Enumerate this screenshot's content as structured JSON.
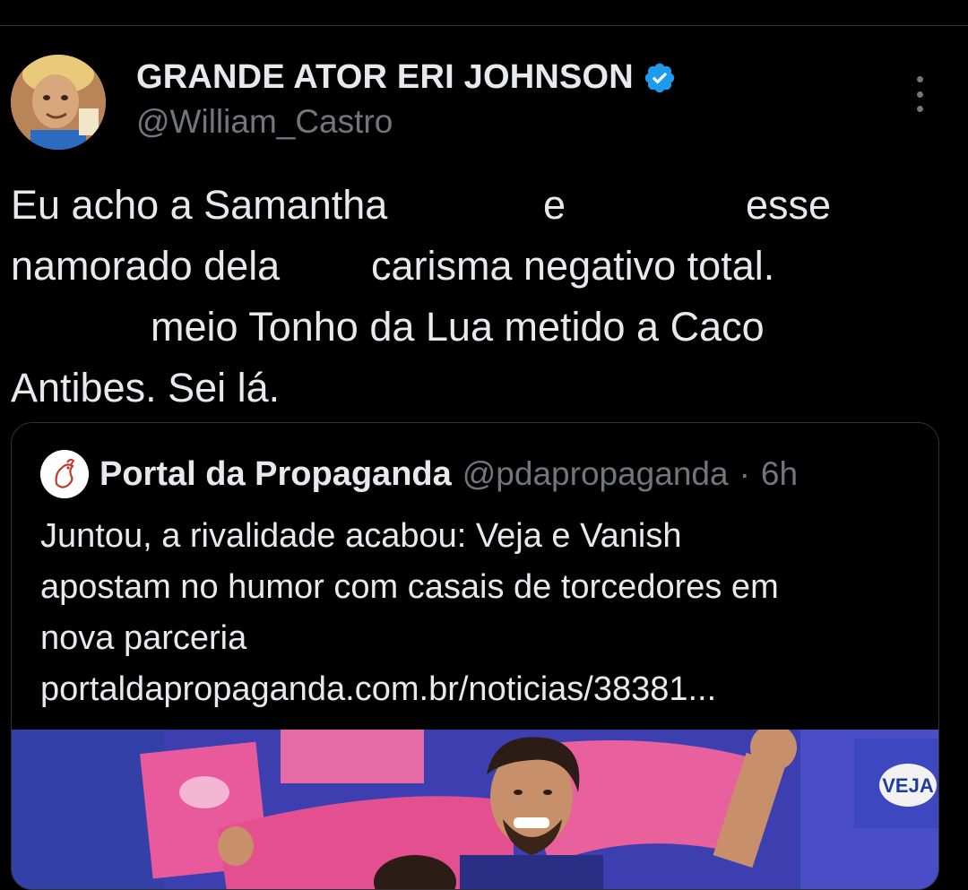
{
  "post": {
    "author": {
      "display_name": "GRANDE ATOR ERI JOHNSON",
      "handle": "@William_Castro",
      "verified_icon": "verified-badge-icon",
      "avatar_icon": "avatar"
    },
    "more_icon": "more-options-icon",
    "text_lines": [
      {
        "segments": [
          "Eu acho a Samantha",
          "e",
          "esse"
        ]
      },
      {
        "segments": [
          "namorado dela",
          "carisma negativo total."
        ]
      },
      {
        "segments": [
          "meio Tonho da Lua metido a Caco"
        ]
      },
      {
        "segments": [
          "Antibes. Sei lá."
        ]
      }
    ]
  },
  "quote": {
    "author": {
      "display_name": "Portal da Propaganda",
      "handle": "@pdapropaganda",
      "separator": "·",
      "time": "6h"
    },
    "text_lines": [
      "Juntou, a rivalidade acabou: Veja e Vanish",
      "apostam no humor com casais de torcedores em",
      "nova parceria",
      "portaldapropaganda.com.br/noticias/38381..."
    ],
    "media": {
      "badge_text": "VEJA"
    }
  },
  "colors": {
    "background": "#000000",
    "text_primary": "#e7e9ea",
    "text_secondary": "#71767b",
    "border": "#2f3336",
    "verified_blue": "#1d9bf0"
  }
}
